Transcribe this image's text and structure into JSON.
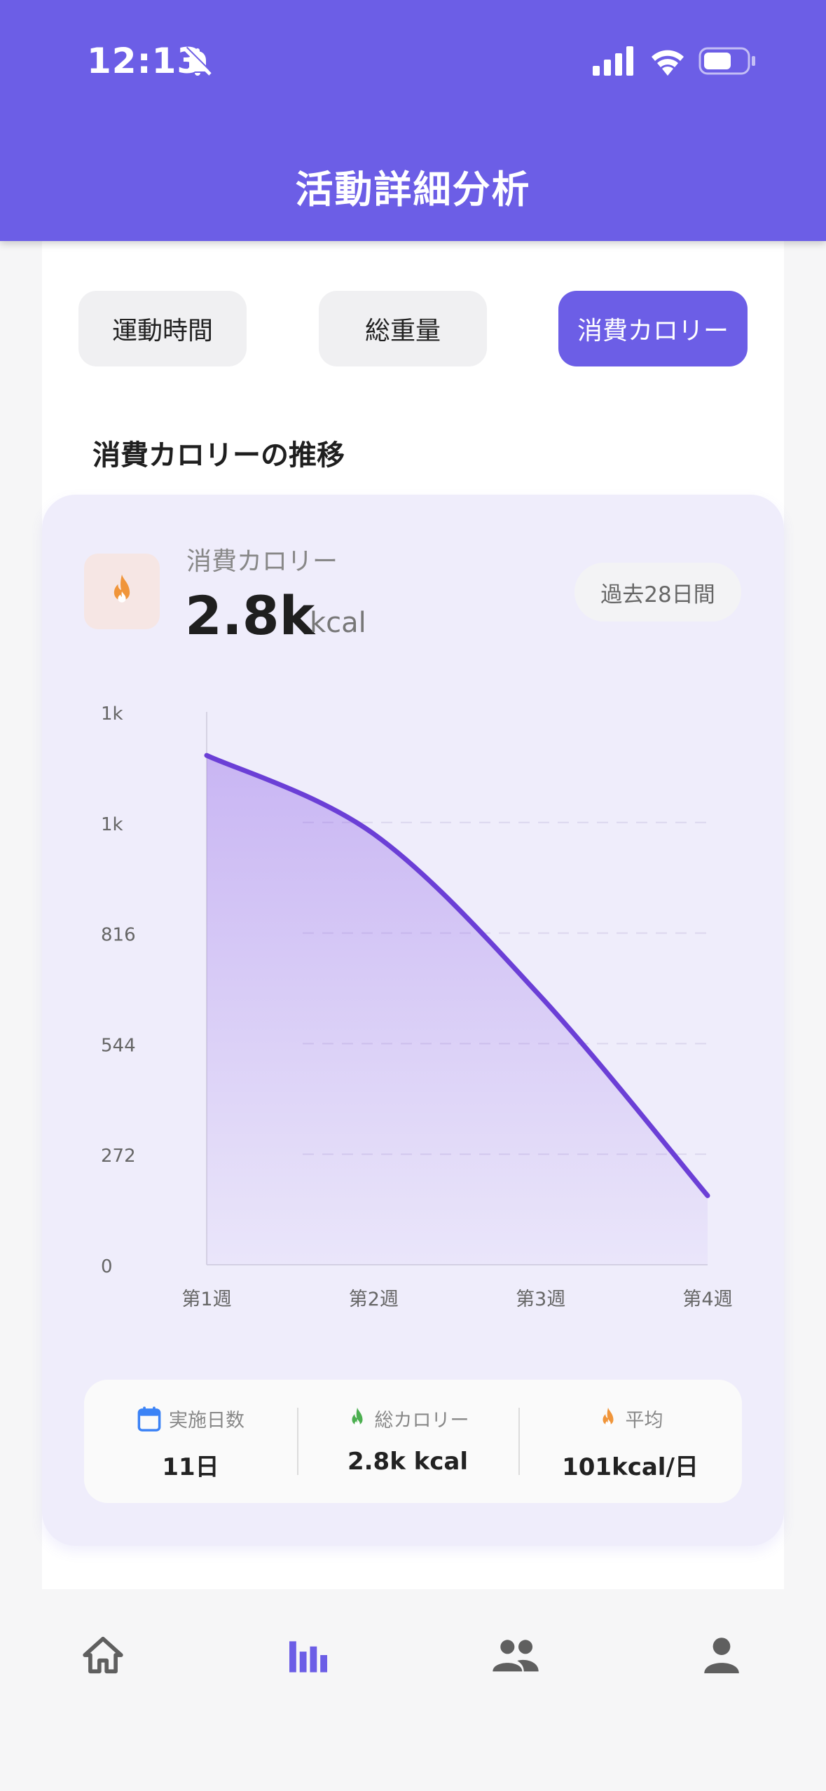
{
  "status_bar": {
    "time": "12:13"
  },
  "header": {
    "title": "活動詳細分析"
  },
  "tabs": [
    {
      "label": "運動時間",
      "active": false
    },
    {
      "label": "総重量",
      "active": false
    },
    {
      "label": "消費カロリー",
      "active": true
    }
  ],
  "section_title": "消費カロリーの推移",
  "summary_card": {
    "label": "消費カロリー",
    "value": "2.8k",
    "unit": "kcal",
    "period": "過去28日間",
    "icon": "flame-icon",
    "accent_color": "#6c5ee6"
  },
  "chart_data": {
    "type": "area",
    "categories": [
      "第1週",
      "第2週",
      "第3週",
      "第4週"
    ],
    "values": [
      1253,
      1060,
      660,
      170
    ],
    "y_ticks": [
      "0",
      "272",
      "544",
      "816",
      "1k",
      "1k"
    ],
    "ylim": [
      0,
      1360
    ],
    "grid": true,
    "line_color": "#6b3fd6"
  },
  "stats": [
    {
      "icon": "calendar-icon",
      "label": "実施日数",
      "value": "11日"
    },
    {
      "icon": "flame-icon",
      "label": "総カロリー",
      "value": "2.8k kcal"
    },
    {
      "icon": "flame-icon",
      "label": "平均",
      "value": "101kcal/日"
    }
  ],
  "bottom_nav": [
    {
      "icon": "home-icon",
      "active": false
    },
    {
      "icon": "bar-chart-icon",
      "active": true
    },
    {
      "icon": "people-icon",
      "active": false
    },
    {
      "icon": "person-icon",
      "active": false
    }
  ]
}
